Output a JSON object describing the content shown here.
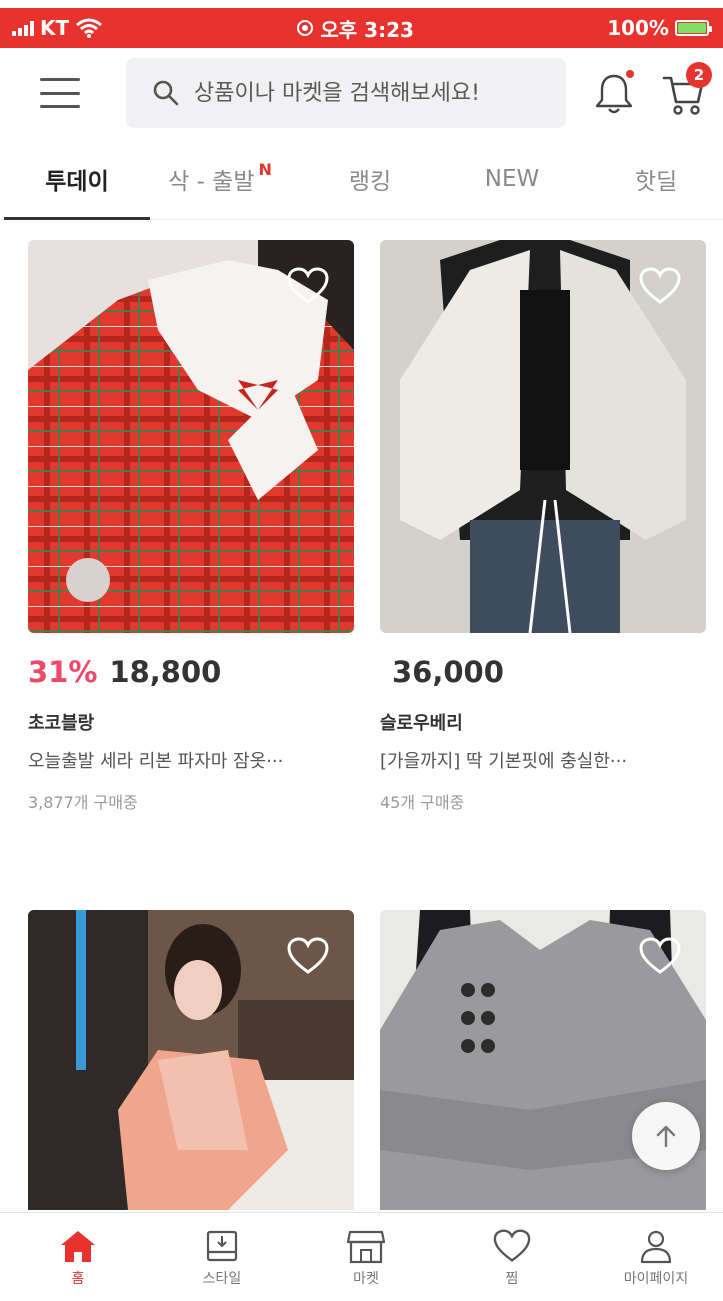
{
  "status_bar": {
    "carrier": "KT",
    "time": "오후 3:23",
    "battery": "100%",
    "battery_level": 1.0
  },
  "header": {
    "search_placeholder": "상품이나 마켓을 검색해보세요!",
    "cart_count": "2"
  },
  "tabs": [
    {
      "label": "투데이",
      "active": true
    },
    {
      "label": "삭 - 출발",
      "new_mark": "N"
    },
    {
      "label": "랭킹"
    },
    {
      "label": "NEW"
    },
    {
      "label": "핫딜"
    }
  ],
  "products": [
    {
      "discount": "31%",
      "price": "18,800",
      "shop": "초코블랑",
      "name": "오늘출발 세라 리본 파자마 잠옷···",
      "sold": "3,877개 구매중"
    },
    {
      "discount": "",
      "price": "36,000",
      "shop": "슬로우베리",
      "name": "[가을까지] 딱 기본핏에 충실한···",
      "sold": "45개 구매중"
    },
    {
      "discount": "",
      "price": "",
      "shop": "",
      "name": "",
      "sold": ""
    },
    {
      "discount": "",
      "price": "",
      "shop": "",
      "name": "",
      "sold": ""
    }
  ],
  "bottom_nav": [
    {
      "label": "홈",
      "icon": "home-icon",
      "active": true
    },
    {
      "label": "스타일",
      "icon": "style-icon"
    },
    {
      "label": "마켓",
      "icon": "store-icon"
    },
    {
      "label": "찜",
      "icon": "heart-icon"
    },
    {
      "label": "마이페이지",
      "icon": "person-icon"
    }
  ],
  "colors": {
    "accent": "#e8322e",
    "discount": "#ee4968"
  }
}
